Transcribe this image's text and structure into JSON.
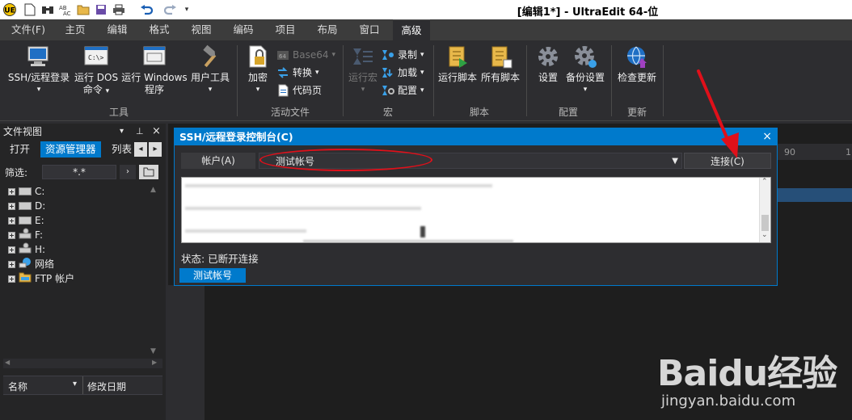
{
  "window": {
    "title": "[编辑1*] - UltraEdit 64-位"
  },
  "menu_tabs": [
    "文件(F)",
    "主页",
    "编辑",
    "格式",
    "视图",
    "编码",
    "项目",
    "布局",
    "窗口",
    "高级"
  ],
  "active_menu_tab": "高级",
  "ribbon": {
    "tools": {
      "label": "工具",
      "ssh": "SSH/远程登录",
      "dos_line1": "运行 DOS",
      "dos_line2": "命令",
      "win_line1": "运行 Windows",
      "win_line2": "程序",
      "user_tools": "用户工具"
    },
    "active_files": {
      "label": "活动文件",
      "encrypt": "加密",
      "base64": "Base64",
      "convert": "转换",
      "codepage": "代码页"
    },
    "macro": {
      "label": "宏",
      "run_macro": "运行宏",
      "record": "录制",
      "load": "加载",
      "config": "配置"
    },
    "script": {
      "label": "脚本",
      "run_script": "运行脚本",
      "all_scripts": "所有脚本"
    },
    "configure": {
      "label": "配置",
      "settings": "设置",
      "backup_settings": "备份设置"
    },
    "update": {
      "label": "更新",
      "check_updates": "检查更新"
    }
  },
  "file_view": {
    "title": "文件视图",
    "tabs": [
      "打开",
      "资源管理器",
      "列表"
    ],
    "active_tab": "资源管理器",
    "filter_label": "筛选:",
    "filter_value": "*.*",
    "tree": [
      "C:",
      "D:",
      "E:",
      "F:",
      "H:",
      "网络",
      "FTP 帐户"
    ],
    "columns": [
      "名称",
      "修改日期"
    ]
  },
  "ssh_console": {
    "title": "SSH/远程登录控制台(C)",
    "account_label": "帐户(A)",
    "account_value": "测试帐号",
    "connect_button": "连接(C)",
    "status": "状态: 已断开连接",
    "session_tab": "测试帐号"
  },
  "ruler": {
    "mark_90": "90"
  },
  "watermark": {
    "brand": "Baidu经验",
    "url": "jingyan.baidu.com"
  },
  "colors": {
    "accent": "#007acc",
    "annotation": "#e0101a",
    "background": "#2d2d30"
  }
}
